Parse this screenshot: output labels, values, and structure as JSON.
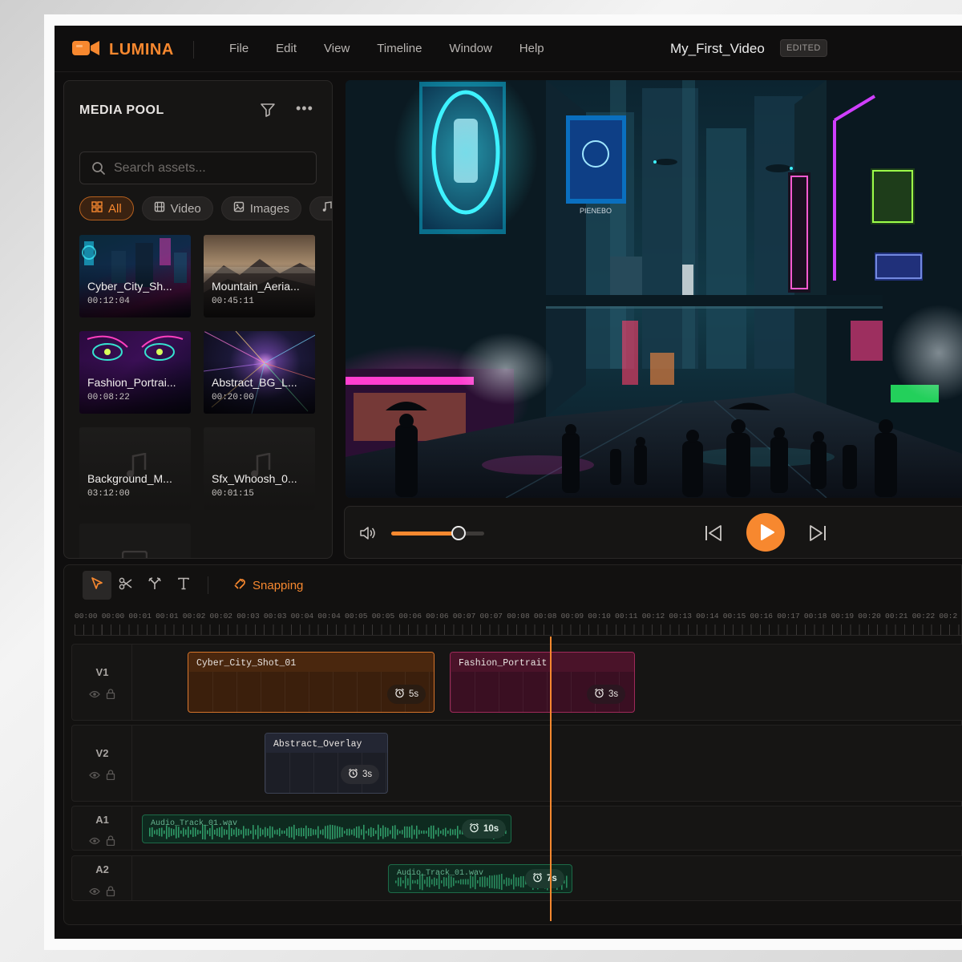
{
  "app": {
    "name": "LUMINA",
    "menu": [
      "File",
      "Edit",
      "View",
      "Timeline",
      "Window",
      "Help"
    ],
    "project_title": "My_First_Video",
    "status_badge": "EDITED",
    "accent": "#f7882f"
  },
  "media_pool": {
    "title": "MEDIA POOL",
    "search_placeholder": "Search assets...",
    "filters": [
      {
        "label": "All",
        "icon": "grid-icon",
        "active": true
      },
      {
        "label": "Video",
        "icon": "film-icon",
        "active": false
      },
      {
        "label": "Images",
        "icon": "image-icon",
        "active": false
      },
      {
        "label": "",
        "icon": "music-icon",
        "active": false
      }
    ],
    "assets": [
      {
        "name": "Cyber_City_Sh...",
        "duration": "00:12:04",
        "kind": "video"
      },
      {
        "name": "Mountain_Aeria...",
        "duration": "00:45:11",
        "kind": "video"
      },
      {
        "name": "Fashion_Portrai...",
        "duration": "00:08:22",
        "kind": "video"
      },
      {
        "name": "Abstract_BG_L...",
        "duration": "00:20:00",
        "kind": "video"
      },
      {
        "name": "Background_M...",
        "duration": "03:12:00",
        "kind": "audio"
      },
      {
        "name": "Sfx_Whoosh_0...",
        "duration": "00:01:15",
        "kind": "audio"
      }
    ]
  },
  "player": {
    "volume": 0.72
  },
  "timeline": {
    "snapping_label": "Snapping",
    "ruler": [
      "00:00",
      "00:00",
      "00:01",
      "00:01",
      "00:02",
      "00:02",
      "00:03",
      "00:03",
      "00:04",
      "00:04",
      "00:05",
      "00:05",
      "00:06",
      "00:06",
      "00:07",
      "00:07",
      "00:08",
      "00:08",
      "00:09",
      "00:10",
      "00:11",
      "00:12",
      "00:13",
      "00:14",
      "00:15",
      "00:16",
      "00:17",
      "00:18",
      "00:19",
      "00:20",
      "00:21",
      "00:22",
      "00:2"
    ],
    "tracks": [
      {
        "name": "V1",
        "clips": [
          {
            "name": "Cyber_City_Shot_01",
            "duration": "5s"
          },
          {
            "name": "Fashion_Portrait",
            "duration": "3s"
          }
        ]
      },
      {
        "name": "V2",
        "clips": [
          {
            "name": "Abstract_Overlay",
            "duration": "3s"
          }
        ]
      },
      {
        "name": "A1",
        "clips": [
          {
            "name": "Audio_Track_01.wav",
            "duration": "10s"
          }
        ]
      },
      {
        "name": "A2",
        "clips": [
          {
            "name": "Audio_Track_01.wav",
            "duration": "7s"
          }
        ]
      }
    ]
  }
}
